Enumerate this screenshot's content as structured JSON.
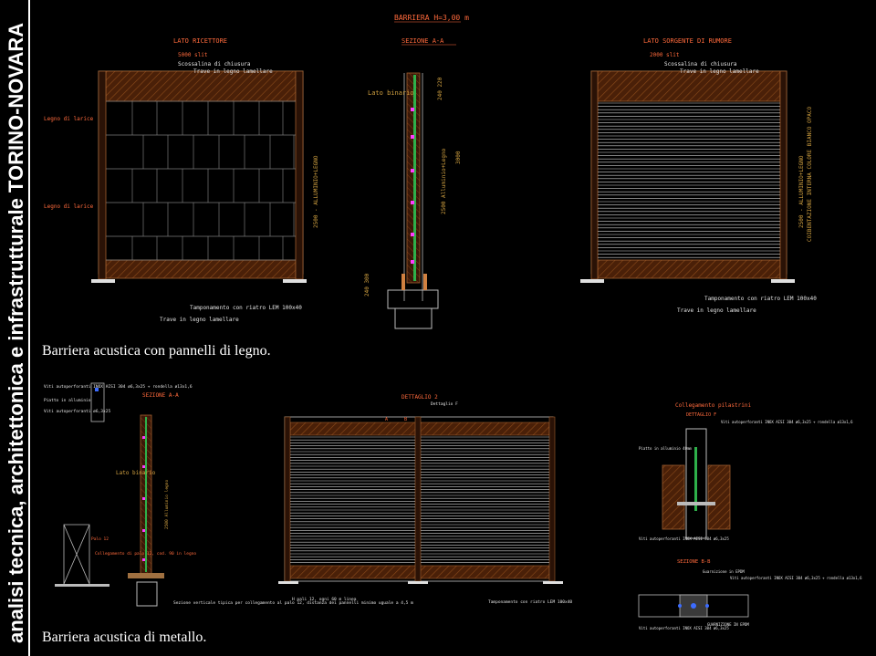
{
  "side_title": "analisi tecnica, architettonica e infrastrutturale TORINO-NOVARA",
  "captions": {
    "wood": "Barriera acustica con pannelli di legno.",
    "metal": "Barriera acustica di metallo."
  },
  "drawing_top": {
    "main_title": "BARRIERA H=3,00 m",
    "left_view": {
      "title": "LATO RICETTORE",
      "span_label": "5000 slit",
      "closing_sheet": "Scossalina di chiusura",
      "glulam_beam": "Trave in legno lamellare",
      "larch_wood_1": "Legno di larice",
      "larch_wood_2": "Legno di larice",
      "temp_note": "Tamponamento con riatro LEM 100x40",
      "glulam_beam_bottom": "Trave in legno lamellare",
      "side_dim": "2500 - ALLUMINIO+LEGNO"
    },
    "section": {
      "title": "SEZIONE A-A",
      "track_side": "Lato binario",
      "wood_label": "2500 Alluminio+Legno",
      "dim_top": "240 220",
      "dim_mid": "3000",
      "dim_bottom": "240 300"
    },
    "right_view": {
      "title": "LATO SORGENTE DI RUMORE",
      "span_label": "2000 slit",
      "closing_sheet": "Scossalina di chiusura",
      "glulam_beam": "Trave in legno lamellare",
      "temp_note": "Tamponamento con riatro LEM 100x40",
      "glulam_beam_bottom": "Trave in legno lamellare",
      "side_dim": "2500 - ALLUMINIO+LEGNO",
      "side_dim_2": "COIBENTAZIONE INTERNA COLORE BIANCO OPACO"
    }
  },
  "drawing_bottom": {
    "left_notes": {
      "bolts": "Viti autoperforanti INOX AISI 304 ø6,3x25 + rondella ø13x1,6",
      "aluminium_plate": "Piatto in alluminio",
      "bolts_2": "Viti autoperforanti ø6,3x25",
      "post": "Palo 12",
      "fixing": "Collegamento di palo 12, cod. 90 in legno",
      "vertical_section": "Sezione verticale tipica per collegamento al palo 12, distanza dei pannelli minimo uguale a 4,5 m"
    },
    "section": {
      "title": "SEZIONE A-A",
      "track_side": "Lato binario",
      "wood_label": "2500 Alluminio legno"
    },
    "elevation": {
      "detail_title": "DETTAGLIO 2",
      "detail_ref": "Dettaglio F",
      "bottom_left": "H pali 12, ogni 60 m linea",
      "bottom_right": "Tamponamento con riatro LEM 100x40",
      "mark_a": "A",
      "mark_b": "B"
    },
    "detail": {
      "title": "Collegamento pilastrini",
      "subtitle": "DETTAGLIO F",
      "screws": "Viti autoperforanti INOX AISI 304 ø6,3x25 + rondella ø13x1,6",
      "plate": "Piatto in alluminio 40mm",
      "screws_2": "Viti autoperforanti INOX AISI 304 ø6,3x25",
      "section_b": "SEZIONE B-B",
      "screws_3": "Viti autoperforanti INOX AISI 304 ø6,3x25 + rondella ø13x1,6",
      "plate_2": "Guarnizione in EPDM",
      "screws_4": "Viti autoperforanti INOX AISI 304 ø6,3x25",
      "gasket": "GUARNIZIONE IN EPDM"
    }
  },
  "colors": {
    "cad_line": "#b8b8b8",
    "cad_text": "#ff6a3c",
    "cad_white": "#e6e6e6",
    "cad_brown": "#5a2a0e",
    "cad_dim": "#d0a040",
    "cad_green": "#38c058",
    "cad_magenta": "#ff3cff"
  }
}
